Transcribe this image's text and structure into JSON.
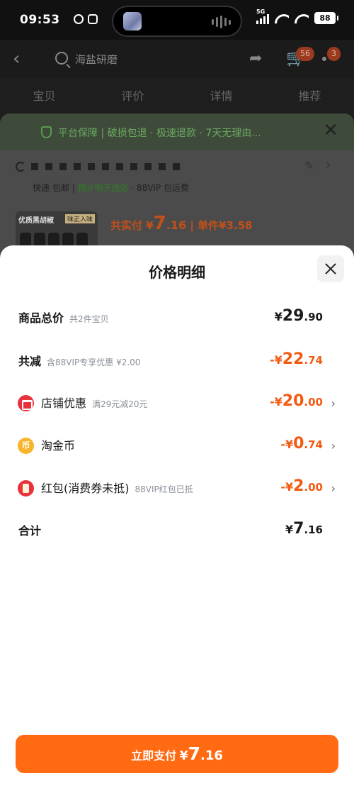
{
  "status_bar": {
    "time": "09:53",
    "battery": "88",
    "network": "5G"
  },
  "background": {
    "search_query": "海盐研磨",
    "cart_badge": "56",
    "msg_badge": "3",
    "tabs": [
      "宝贝",
      "评价",
      "详情",
      "推荐"
    ],
    "guarantee": "平台保障 | 破损包退 · 极速退款 · 7天无理由...",
    "delivery": {
      "prefix": "快递 包邮 | ",
      "highlight": "预计明天送达",
      "suffix": " · 88VIP 包运费"
    },
    "product_thumb": {
      "title": "优质黑胡椒",
      "tag": "味正入味"
    },
    "pay": {
      "label": "共实付 ¥",
      "int": "7",
      "dec": ".16",
      "unit": " | 单件¥3.58"
    }
  },
  "sheet": {
    "title": "价格明细",
    "rows": [
      {
        "label": "商品总价",
        "sub": "共2件宝贝",
        "sym": "¥",
        "int": "29",
        "dec": ".90"
      },
      {
        "label": "共减",
        "sub": "含88VIP专享优惠 ¥2.00",
        "sym": "-¥",
        "int": "22",
        "dec": ".74"
      },
      {
        "label": "店铺优惠",
        "sub": "满29元减20元",
        "sym": "-¥",
        "int": "20",
        "dec": ".00",
        "icon": "shop-icon"
      },
      {
        "label": "淘金币",
        "sub": "",
        "sym": "-¥",
        "int": "0",
        "dec": ".74",
        "icon": "coin-icon",
        "icon_glyph": "币"
      },
      {
        "label": "红包(消费券未抵)",
        "sub": "88VIP红包已抵",
        "sym": "-¥",
        "int": "2",
        "dec": ".00",
        "icon": "red-envelope-icon"
      },
      {
        "label": "合计",
        "sub": "",
        "sym": "¥",
        "int": "7",
        "dec": ".16"
      }
    ],
    "pay_button": {
      "label": "立即支付",
      "sym": "¥",
      "int": "7",
      "dec": ".16"
    }
  },
  "colors": {
    "accent_orange": "#f25a12",
    "button_orange": "#ff6a13",
    "guarantee_green": "#6aa860"
  }
}
